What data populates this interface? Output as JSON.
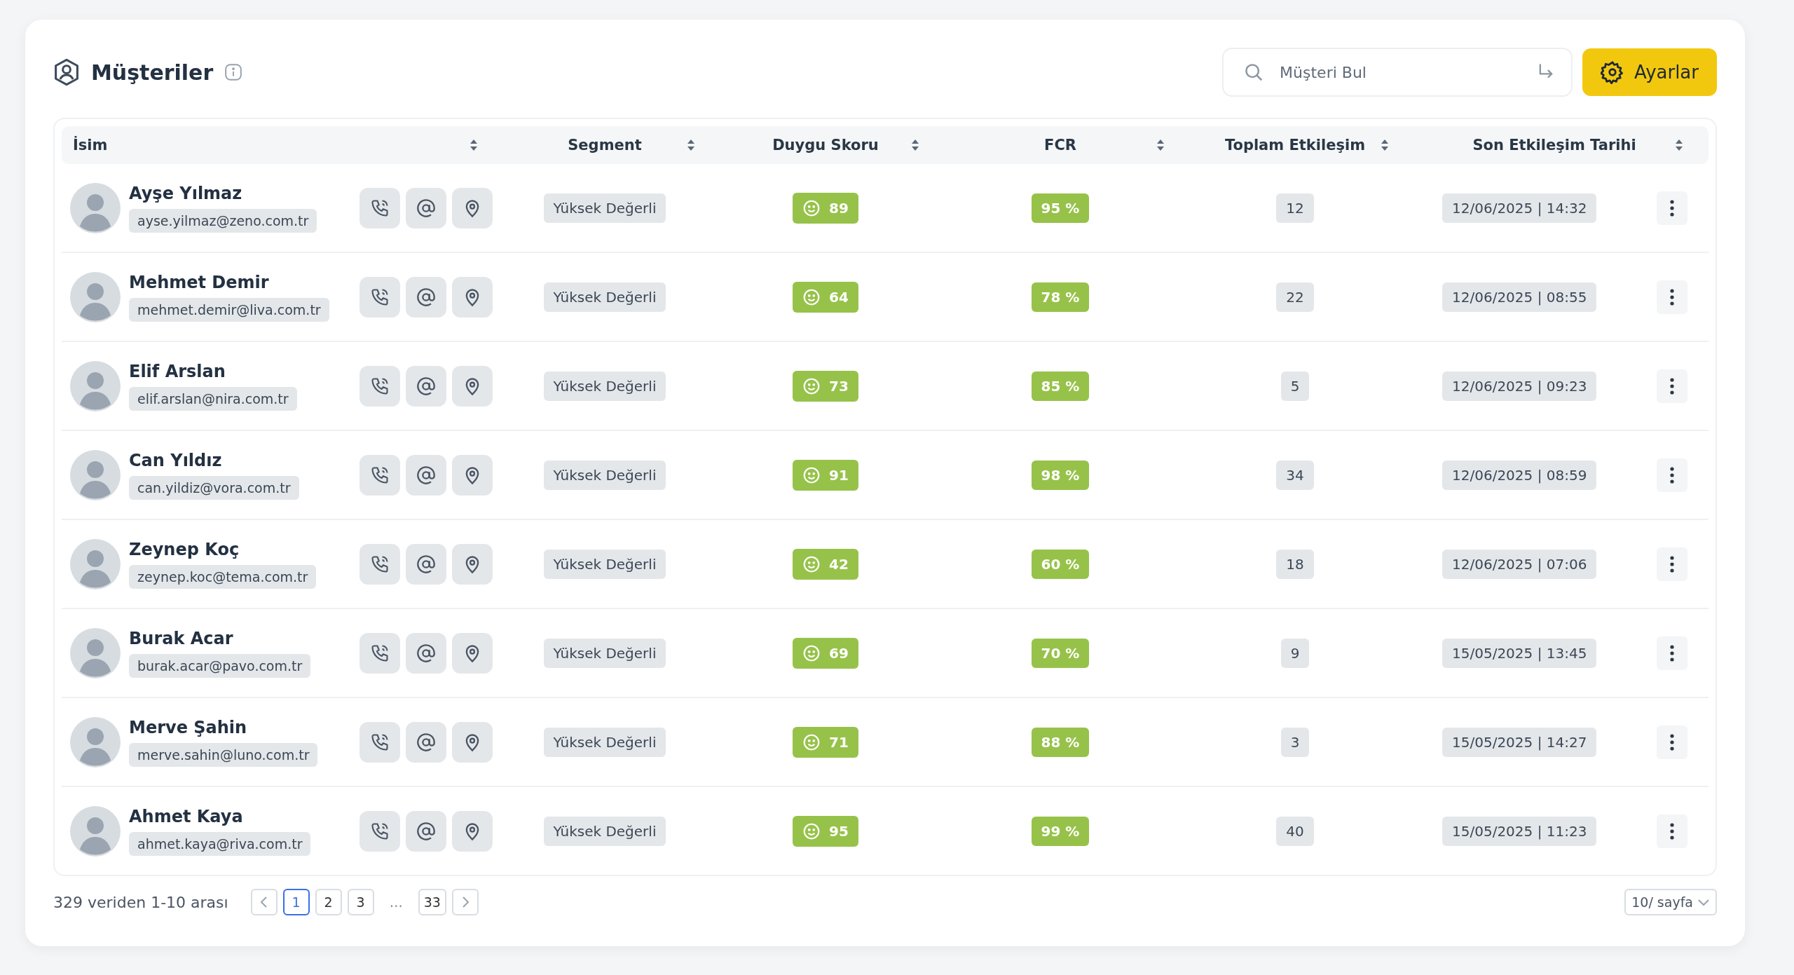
{
  "header": {
    "title": "Müşteriler",
    "search": {
      "placeholder": "Müşteri Bul"
    },
    "settings_button": "Ayarlar"
  },
  "table": {
    "columns": [
      "İsim",
      "Segment",
      "Duygu Skoru",
      "FCR",
      "Toplam Etkileşim",
      "Son Etkileşim Tarihi"
    ],
    "rows": [
      {
        "name": "Ayşe Yılmaz",
        "email": "ayse.yilmaz@zeno.com.tr",
        "segment": "Yüksek Değerli",
        "sentiment": "89",
        "fcr": "95 %",
        "total": "12",
        "last": "12/06/2025 | 14:32"
      },
      {
        "name": "Mehmet Demir",
        "email": "mehmet.demir@liva.com.tr",
        "segment": "Yüksek Değerli",
        "sentiment": "64",
        "fcr": "78 %",
        "total": "22",
        "last": "12/06/2025 | 08:55"
      },
      {
        "name": "Elif Arslan",
        "email": "elif.arslan@nira.com.tr",
        "segment": "Yüksek Değerli",
        "sentiment": "73",
        "fcr": "85 %",
        "total": "5",
        "last": "12/06/2025 | 09:23"
      },
      {
        "name": "Can Yıldız",
        "email": "can.yildiz@vora.com.tr",
        "segment": "Yüksek Değerli",
        "sentiment": "91",
        "fcr": "98 %",
        "total": "34",
        "last": "12/06/2025 | 08:59"
      },
      {
        "name": "Zeynep Koç",
        "email": "zeynep.koc@tema.com.tr",
        "segment": "Yüksek Değerli",
        "sentiment": "42",
        "fcr": "60 %",
        "total": "18",
        "last": "12/06/2025 | 07:06"
      },
      {
        "name": "Burak Acar",
        "email": "burak.acar@pavo.com.tr",
        "segment": "Yüksek Değerli",
        "sentiment": "69",
        "fcr": "70 %",
        "total": "9",
        "last": "15/05/2025 | 13:45"
      },
      {
        "name": "Merve Şahin",
        "email": "merve.sahin@luno.com.tr",
        "segment": "Yüksek Değerli",
        "sentiment": "71",
        "fcr": "88 %",
        "total": "3",
        "last": "15/05/2025 | 14:27"
      },
      {
        "name": "Ahmet Kaya",
        "email": "ahmet.kaya@riva.com.tr",
        "segment": "Yüksek Değerli",
        "sentiment": "95",
        "fcr": "99 %",
        "total": "40",
        "last": "15/05/2025 | 11:23"
      }
    ]
  },
  "pagination": {
    "summary": "329 veriden 1-10 arası",
    "pages": [
      {
        "label": "1",
        "selected": true
      },
      {
        "label": "2",
        "selected": false
      },
      {
        "label": "3",
        "selected": false
      },
      {
        "label": "…",
        "kind": "ellipsis",
        "selected": false
      },
      {
        "label": "33",
        "selected": false
      }
    ],
    "page_size": "10/ sayfa"
  }
}
